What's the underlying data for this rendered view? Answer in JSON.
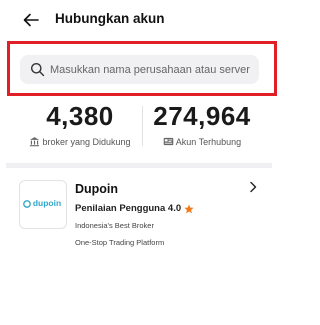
{
  "header": {
    "title": "Hubungkan akun",
    "back_icon": "arrow-left-icon"
  },
  "search": {
    "placeholder": "Masukkan nama perusahaan atau server",
    "value": "",
    "icon": "search-icon",
    "highlight_color": "#e01f26"
  },
  "stats": [
    {
      "value": "4,380",
      "label": "broker yang Didukung",
      "icon": "bank-icon"
    },
    {
      "value": "274,964",
      "label": "Akun Terhubung",
      "icon": "id-card-icon"
    }
  ],
  "broker": {
    "name": "Dupoin",
    "logo_text": "dupoin",
    "rating_label": "Penilaian Pengguna 4.0",
    "tagline": "Indonesia's Best Broker",
    "description": "One-Stop Trading Platform",
    "logo_color": "#2fa7c9",
    "star_color": "#f07a1e"
  }
}
